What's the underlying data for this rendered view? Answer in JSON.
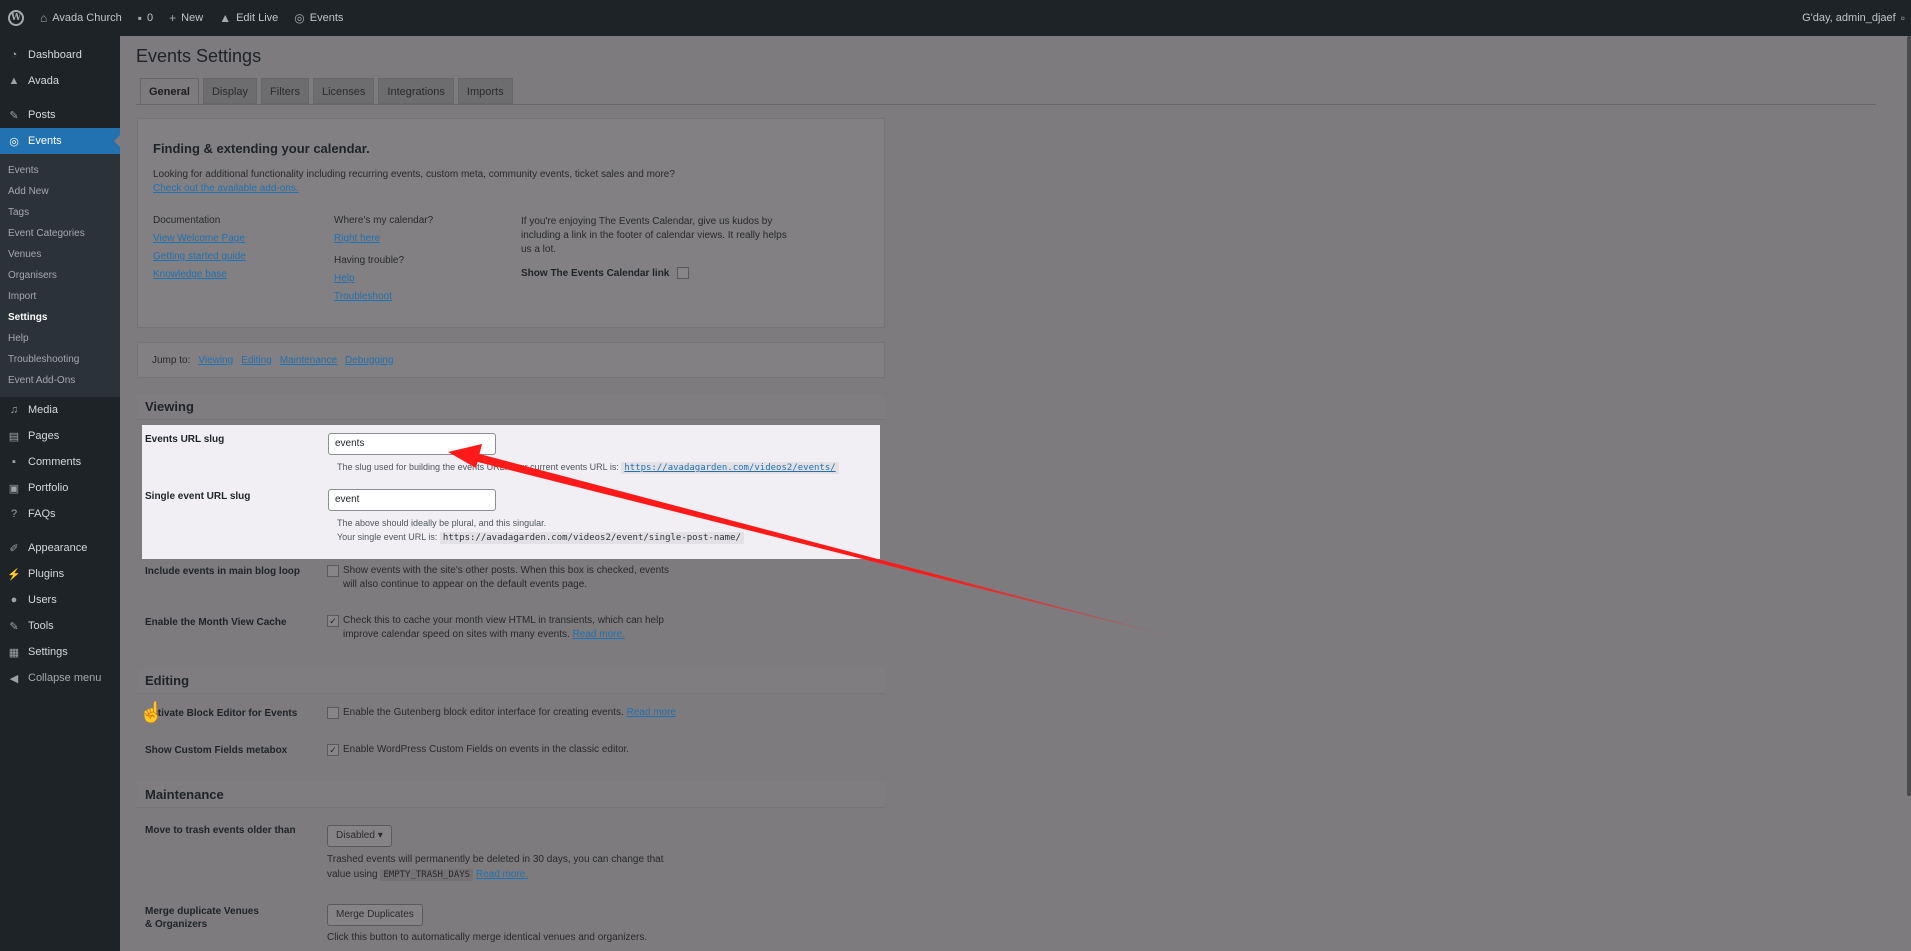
{
  "adminbar": {
    "site": "Avada Church",
    "comments_count": "0",
    "new": "New",
    "edit_live": "Edit Live",
    "events": "Events",
    "greeting": "G'day, admin_djaef"
  },
  "sidebar": {
    "top_items": [
      {
        "label": "Dashboard",
        "icon": "dashboard-icon"
      },
      {
        "label": "Avada",
        "icon": "avada-icon"
      },
      {
        "label": "Posts",
        "icon": "pin-icon"
      },
      {
        "label": "Events",
        "icon": "calendar-icon"
      }
    ],
    "events_sub": [
      "Events",
      "Add New",
      "Tags",
      "Event Categories",
      "Venues",
      "Organisers",
      "Import",
      "Settings",
      "Help",
      "Troubleshooting",
      "Event Add-Ons"
    ],
    "bottom_items": [
      {
        "label": "Media",
        "icon": "media-icon"
      },
      {
        "label": "Pages",
        "icon": "pages-icon"
      },
      {
        "label": "Comments",
        "icon": "comments-icon"
      },
      {
        "label": "Portfolio",
        "icon": "portfolio-icon"
      },
      {
        "label": "FAQs",
        "icon": "faq-icon"
      },
      {
        "label": "Appearance",
        "icon": "brush-icon"
      },
      {
        "label": "Plugins",
        "icon": "plugin-icon"
      },
      {
        "label": "Users",
        "icon": "users-icon"
      },
      {
        "label": "Tools",
        "icon": "tools-icon"
      },
      {
        "label": "Settings",
        "icon": "settings-icon"
      },
      {
        "label": "Collapse menu",
        "icon": "collapse-icon"
      }
    ]
  },
  "page": {
    "title": "Events Settings",
    "tabs": [
      "General",
      "Display",
      "Filters",
      "Licenses",
      "Integrations",
      "Imports"
    ]
  },
  "promo": {
    "heading": "Finding & extending your calendar.",
    "intro": "Looking for additional functionality including recurring events, custom meta, community events, ticket sales and more?",
    "intro_link": "Check out the available add-ons.",
    "col1": {
      "title": "Documentation",
      "links": [
        "View Welcome Page",
        "Getting started guide",
        "Knowledge base"
      ]
    },
    "col2": {
      "title": "Where's my calendar?",
      "link1": "Right here",
      "title2": "Having trouble?",
      "links2": [
        "Help",
        "Troubleshoot"
      ]
    },
    "kudos_text": "If you're enjoying The Events Calendar, give us kudos by including a link in the footer of calendar views. It really helps us a lot.",
    "kudos_label": "Show The Events Calendar link"
  },
  "jump": {
    "label": "Jump to:",
    "links": [
      "Viewing",
      "Editing",
      "Maintenance",
      "Debugging"
    ]
  },
  "viewing": {
    "heading": "Viewing",
    "url_slug_label": "Events URL slug",
    "url_slug_value": "events",
    "url_slug_desc": "The slug used for building the events URL. Your current events URL is:",
    "url_slug_link": "https://avadagarden.com/videos2/events/",
    "single_label": "Single event URL slug",
    "single_value": "event",
    "single_desc1": "The above should ideally be plural, and this singular.",
    "single_desc2": "Your single event URL is:",
    "single_code": "https://avadagarden.com/videos2/event/single-post-name/",
    "loop_label": "Include events in main blog loop",
    "loop_desc": "Show events with the site's other posts. When this box is checked, events will also continue to appear on the default events page.",
    "cache_label": "Enable the Month View Cache",
    "cache_desc": "Check this to cache your month view HTML in transients, which can help improve calendar speed on sites with many events.",
    "read_more": "Read more."
  },
  "editing": {
    "heading": "Editing",
    "block_label": "Activate Block Editor for Events",
    "block_desc": "Enable the Gutenberg block editor interface for creating events.",
    "read_more": "Read more",
    "custom_label": "Show Custom Fields metabox",
    "custom_desc": "Enable WordPress Custom Fields on events in the classic editor."
  },
  "maintenance": {
    "heading": "Maintenance",
    "trash_label": "Move to trash events older than",
    "trash_select": "Disabled",
    "trash_desc1": "Trashed events will permanently be deleted in 30 days, you can change that",
    "trash_desc2": "value using",
    "trash_code": "EMPTY_TRASH_DAYS",
    "read_more": "Read more.",
    "merge_label": "Merge duplicate Venues & Organizers",
    "merge_button": "Merge Duplicates",
    "merge_desc": "Click this button to automatically merge identical venues and organizers."
  },
  "colors": {
    "accent": "#2271b1",
    "arrow": "#ff1a1a",
    "highlight": "#f1eff3"
  }
}
